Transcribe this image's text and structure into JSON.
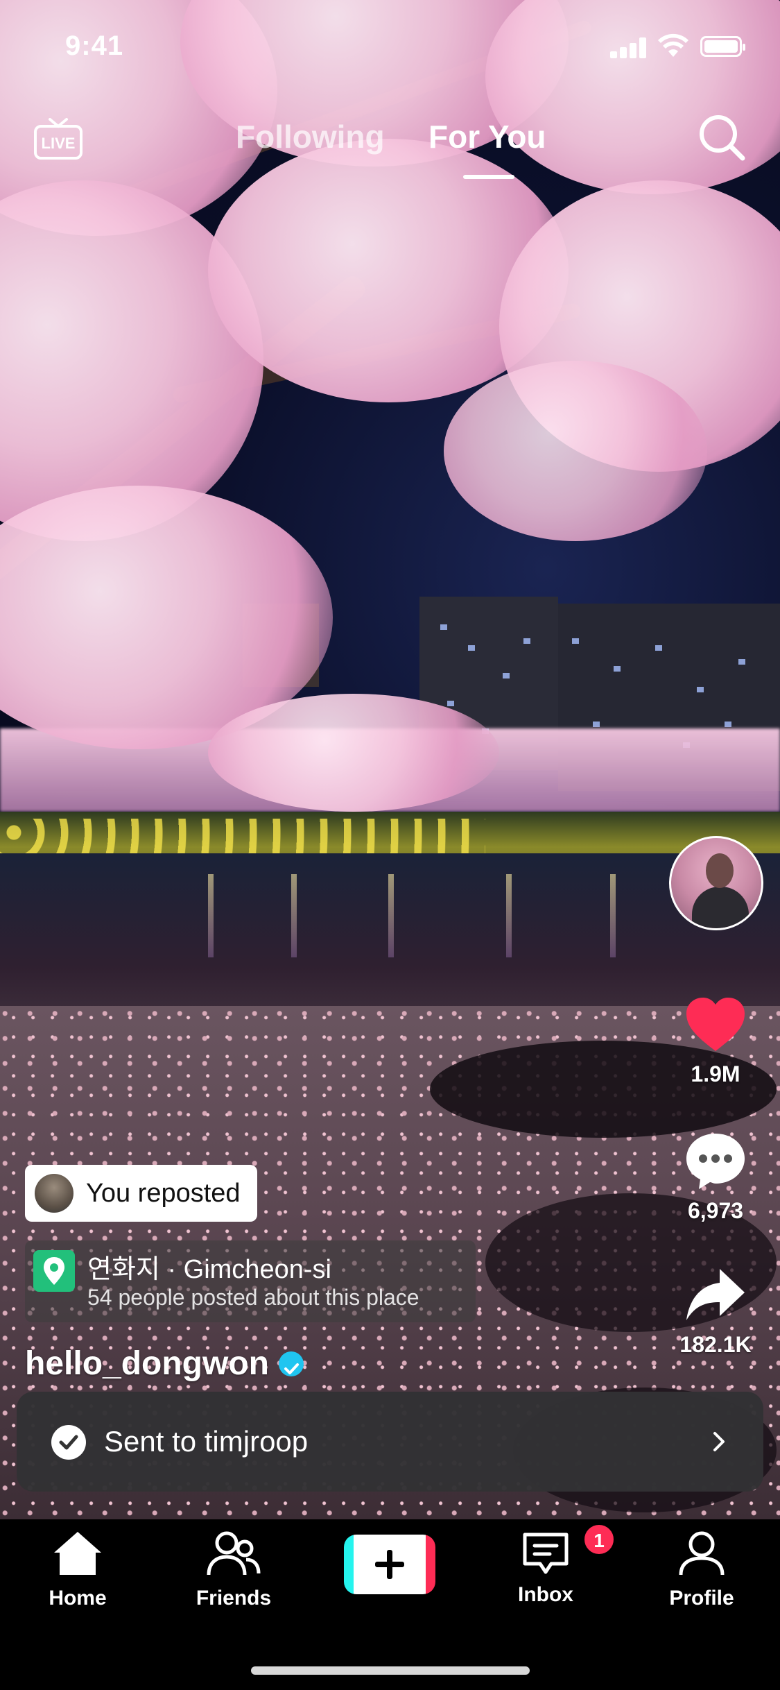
{
  "status_bar": {
    "time": "9:41"
  },
  "top_nav": {
    "live_label": "LIVE",
    "tabs": [
      {
        "label": "Following",
        "active": false
      },
      {
        "label": "For You",
        "active": true
      }
    ]
  },
  "actions": {
    "likes": "1.9M",
    "comments": "6,973",
    "shares": "182.1K"
  },
  "post": {
    "repost_label": "You reposted",
    "location_title": "연화지 · Gimcheon-si",
    "location_subtitle": "54 people posted about this place",
    "username": "hello_dongwon",
    "verified": true
  },
  "toast": {
    "message": "Sent to timjroop"
  },
  "bottom_nav": {
    "items": [
      {
        "label": "Home",
        "icon": "home-icon"
      },
      {
        "label": "Friends",
        "icon": "friends-icon"
      },
      {
        "label": "",
        "icon": "plus-icon"
      },
      {
        "label": "Inbox",
        "icon": "inbox-icon",
        "badge": "1"
      },
      {
        "label": "Profile",
        "icon": "profile-icon"
      }
    ]
  },
  "colors": {
    "like": "#fe2c55",
    "verified": "#20c5f0",
    "location_pin": "#22c07b",
    "accent_cyan": "#25f4ee",
    "accent_red": "#fe2c55"
  }
}
